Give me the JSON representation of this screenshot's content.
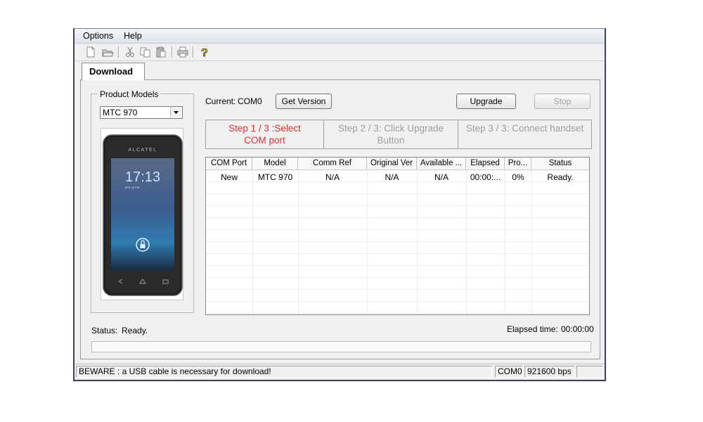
{
  "menu": {
    "items": [
      "Options",
      "Help"
    ]
  },
  "toolbar": {
    "icons": [
      "new-file-icon",
      "open-folder-icon",
      "cut-icon",
      "copy-icon",
      "paste-icon",
      "print-icon",
      "help-icon"
    ]
  },
  "tabs": {
    "download": "Download"
  },
  "product_models": {
    "label": "Product Models",
    "selected": "MTC 970",
    "phone_brand": "ALCATEL",
    "phone_time": "17:13",
    "phone_date": "APR 20 FRI"
  },
  "current": {
    "label": "Current:",
    "value": "COM0"
  },
  "buttons": {
    "get_version": "Get Version",
    "upgrade": "Upgrade",
    "stop": "Stop"
  },
  "steps": [
    {
      "line1": "Step 1 / 3 :Select",
      "line2": "COM port",
      "color": "#e03030"
    },
    {
      "line1": "Step 2 / 3: Click Upgrade",
      "line2": "Button",
      "color": "#a0a0a0"
    },
    {
      "line1": "Step 3 / 3: Connect handset",
      "line2": "",
      "color": "#a0a0a0"
    }
  ],
  "grid": {
    "headers": [
      "COM Port",
      "Model",
      "Comm Ref",
      "Original Ver",
      "Available ...",
      "Elapsed",
      "Pro...",
      "Status"
    ],
    "rows": [
      [
        "New",
        "MTC 970",
        "N/A",
        "N/A",
        "N/A",
        "00:00:...",
        "0%",
        "Ready."
      ]
    ]
  },
  "status": {
    "label": "Status:",
    "value": "Ready.",
    "elapsed_label": "Elapsed time:",
    "elapsed_value": "00:00:00"
  },
  "statusbar": {
    "message": "BEWARE : a USB cable is necessary for download!",
    "port": "COM0",
    "baud": "921600 bps"
  }
}
